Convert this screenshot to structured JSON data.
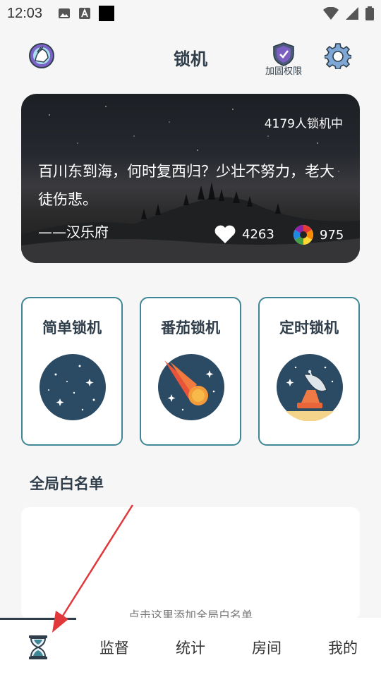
{
  "status_bar": {
    "time": "12:03"
  },
  "header": {
    "title": "锁机",
    "shield_label": "加固权限"
  },
  "quote": {
    "lock_count": "4179人锁机中",
    "text": "百川东到海，何时复西归？少壮不努力，老大徒伤悲。",
    "author": "——汉乐府",
    "likes": "4263",
    "views": "975"
  },
  "modes": [
    {
      "label": "简单锁机",
      "icon": "starry-planet-icon"
    },
    {
      "label": "番茄锁机",
      "icon": "meteor-icon"
    },
    {
      "label": "定时锁机",
      "icon": "satellite-dish-icon"
    }
  ],
  "whitelist": {
    "title": "全局白名单",
    "hint": "点击这里添加全局白名单"
  },
  "nav": [
    {
      "label": "",
      "icon": "hourglass-icon",
      "active": true
    },
    {
      "label": "监督"
    },
    {
      "label": "统计"
    },
    {
      "label": "房间"
    },
    {
      "label": "我的"
    }
  ],
  "colors": {
    "accent": "#3f8796",
    "dark": "#2f3e4a",
    "arrow": "#e0383b"
  }
}
